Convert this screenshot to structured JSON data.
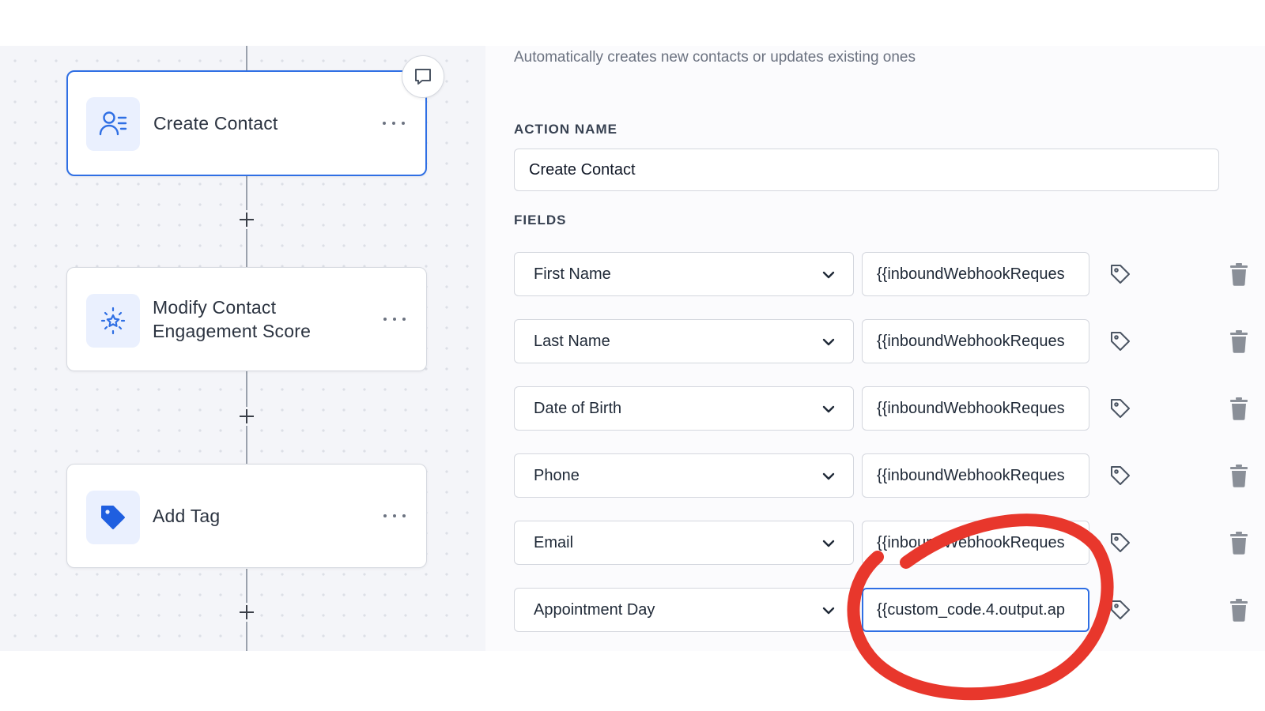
{
  "canvas": {
    "nodes": [
      {
        "title": "Create Contact",
        "icon": "contact-list-icon",
        "selected": true
      },
      {
        "title": "Modify Contact Engagement Score",
        "icon": "sparkle-star-icon",
        "selected": false
      },
      {
        "title": "Add Tag",
        "icon": "tag-filled-icon",
        "selected": false
      }
    ]
  },
  "panel": {
    "description": "Automatically creates new contacts or updates existing ones",
    "action_name_label": "ACTION NAME",
    "action_name_value": "Create Contact",
    "fields_label": "FIELDS",
    "fields": [
      {
        "field": "First Name",
        "value": "{{inboundWebhookReques"
      },
      {
        "field": "Last Name",
        "value": "{{inboundWebhookReques"
      },
      {
        "field": "Date of Birth",
        "value": "{{inboundWebhookReques"
      },
      {
        "field": "Phone",
        "value": "{{inboundWebhookReques"
      },
      {
        "field": "Email",
        "value": "{{inboundWebhookReques"
      },
      {
        "field": "Appointment Day",
        "value": "{{custom_code.4.output.ap"
      }
    ]
  },
  "colors": {
    "accent": "#2f6fe4",
    "annotation": "#e8372c",
    "canvas_bg": "#f4f5f9"
  }
}
